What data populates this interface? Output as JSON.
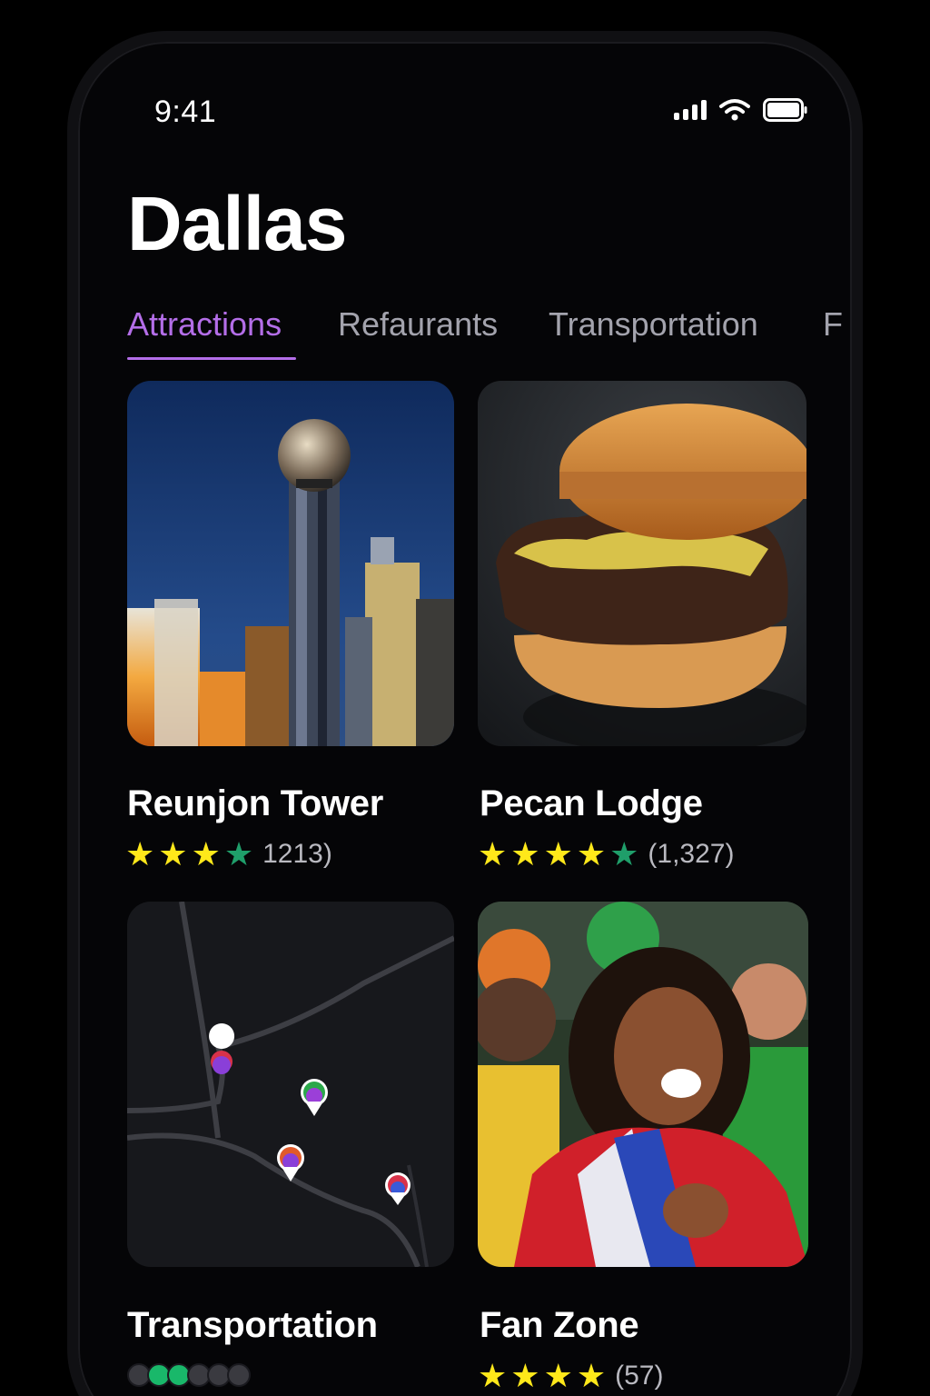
{
  "status": {
    "time": "9:41"
  },
  "city": "Dallas",
  "tabs": [
    {
      "label": "Attractions",
      "active": true
    },
    {
      "label": "Refaurants",
      "active": false
    },
    {
      "label": "Transportation",
      "active": false
    },
    {
      "label": "F",
      "active": false
    }
  ],
  "cards": [
    {
      "title": "Reunjon Tower",
      "rating": 3.5,
      "count": "1213)"
    },
    {
      "title": "Pecan Lodge",
      "rating": 4.5,
      "count": "(1,327)"
    },
    {
      "title": "Transportation",
      "rating_dots": [
        "#3a3a40",
        "#19b86a",
        "#19b86a",
        "#3a3a40",
        "#3a3a40",
        "#3a3a40"
      ]
    },
    {
      "title": "Fan Zone",
      "rating": 4,
      "count": "(57)"
    }
  ],
  "colors": {
    "accent": "#b46ee8",
    "star": "#ffe81a",
    "star_partial": "#1f9e6a"
  }
}
